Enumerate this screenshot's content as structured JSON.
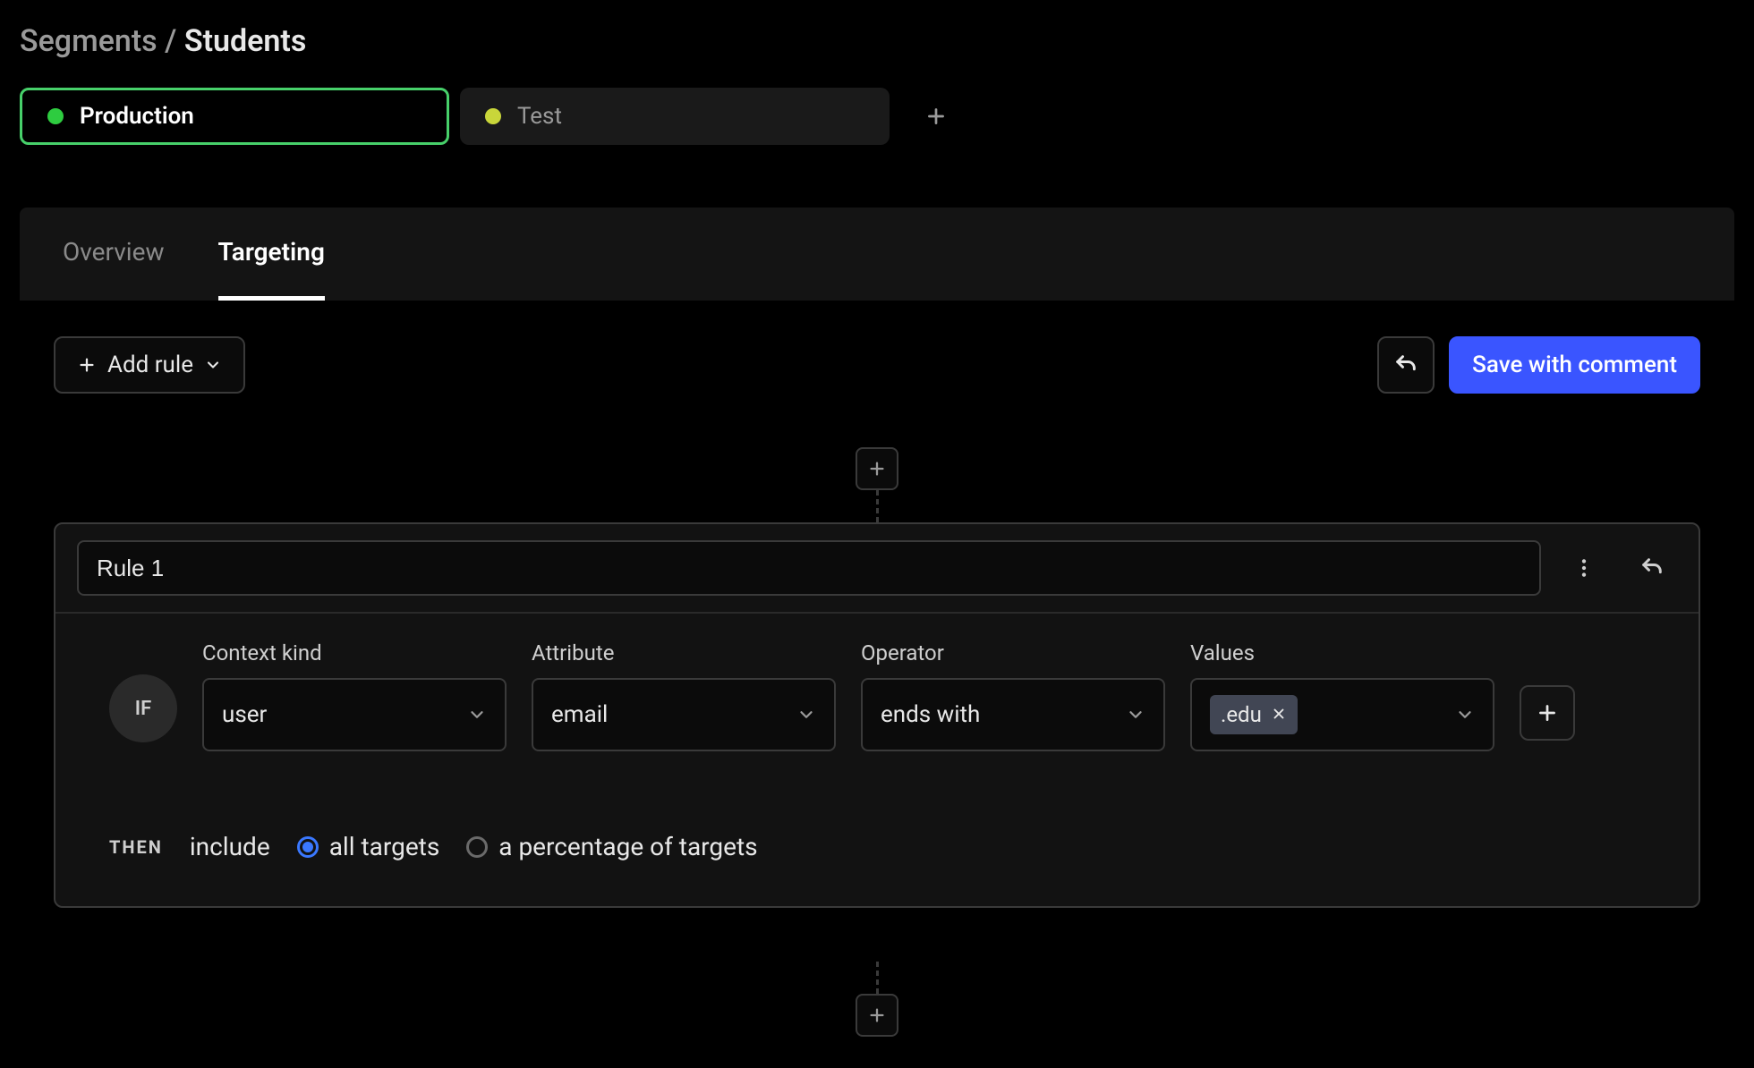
{
  "breadcrumb": {
    "root": "Segments",
    "sep": "/",
    "current": "Students"
  },
  "envs": [
    {
      "name": "Production",
      "dot": "green",
      "active": true
    },
    {
      "name": "Test",
      "dot": "yellow",
      "active": false
    }
  ],
  "tabs": [
    {
      "label": "Overview",
      "active": false
    },
    {
      "label": "Targeting",
      "active": true
    }
  ],
  "actions": {
    "add_rule": "Add rule",
    "save": "Save with comment"
  },
  "rule": {
    "name": "Rule 1",
    "if_label": "IF",
    "then_label": "THEN",
    "fields": {
      "context_kind": {
        "label": "Context kind",
        "value": "user"
      },
      "attribute": {
        "label": "Attribute",
        "value": "email"
      },
      "operator": {
        "label": "Operator",
        "value": "ends with"
      },
      "values": {
        "label": "Values",
        "chips": [
          ".edu"
        ]
      }
    },
    "then": {
      "include": "include",
      "opt_all": "all targets",
      "opt_pct": "a percentage of targets",
      "selected": "all"
    }
  }
}
